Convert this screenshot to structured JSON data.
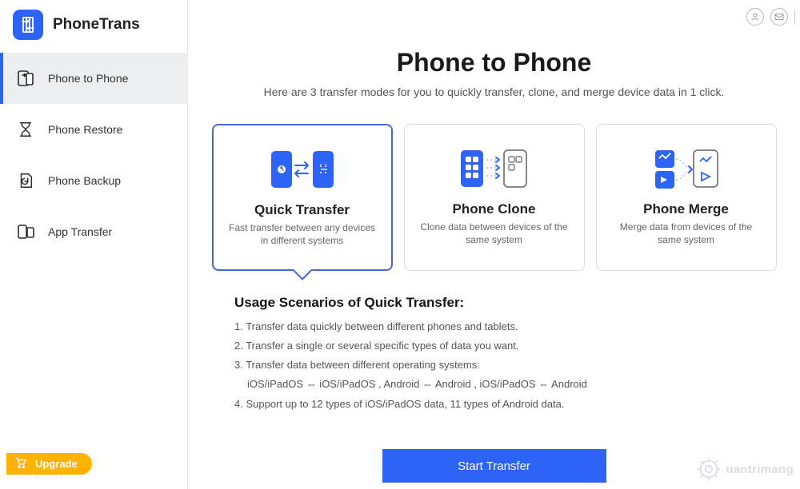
{
  "app": {
    "name": "PhoneTrans"
  },
  "sidebar": {
    "items": [
      {
        "label": "Phone to Phone",
        "active": true
      },
      {
        "label": "Phone Restore",
        "active": false
      },
      {
        "label": "Phone Backup",
        "active": false
      },
      {
        "label": "App Transfer",
        "active": false
      }
    ],
    "upgrade_label": "Upgrade"
  },
  "page": {
    "title": "Phone to Phone",
    "subtitle": "Here are 3 transfer modes for you to quickly transfer, clone, and merge device data in 1 click."
  },
  "cards": [
    {
      "title": "Quick Transfer",
      "desc": "Fast transfer between any devices in different systems",
      "selected": true
    },
    {
      "title": "Phone Clone",
      "desc": "Clone data between devices of the same system",
      "selected": false
    },
    {
      "title": "Phone Merge",
      "desc": "Merge data from devices of the same system",
      "selected": false
    }
  ],
  "scenarios": {
    "title": "Usage Scenarios of Quick Transfer:",
    "lines": [
      "1. Transfer data quickly between different phones and tablets.",
      "2. Transfer a single or several specific types of data you want.",
      "3. Transfer data between different operating systems:"
    ],
    "os_line": "iOS/iPadOS ⇔ iOS/iPadOS ,   Android ⇔ Android ,   iOS/iPadOS ⇔ Android",
    "line4": "4. Support up to 12 types of iOS/iPadOS data, 11 types of Android data."
  },
  "cta": {
    "label": "Start Transfer"
  },
  "watermark": {
    "text": "uantrimang"
  },
  "colors": {
    "primary": "#2d63f6",
    "accent_border": "#4a66d6",
    "upgrade": "#ffb200"
  }
}
